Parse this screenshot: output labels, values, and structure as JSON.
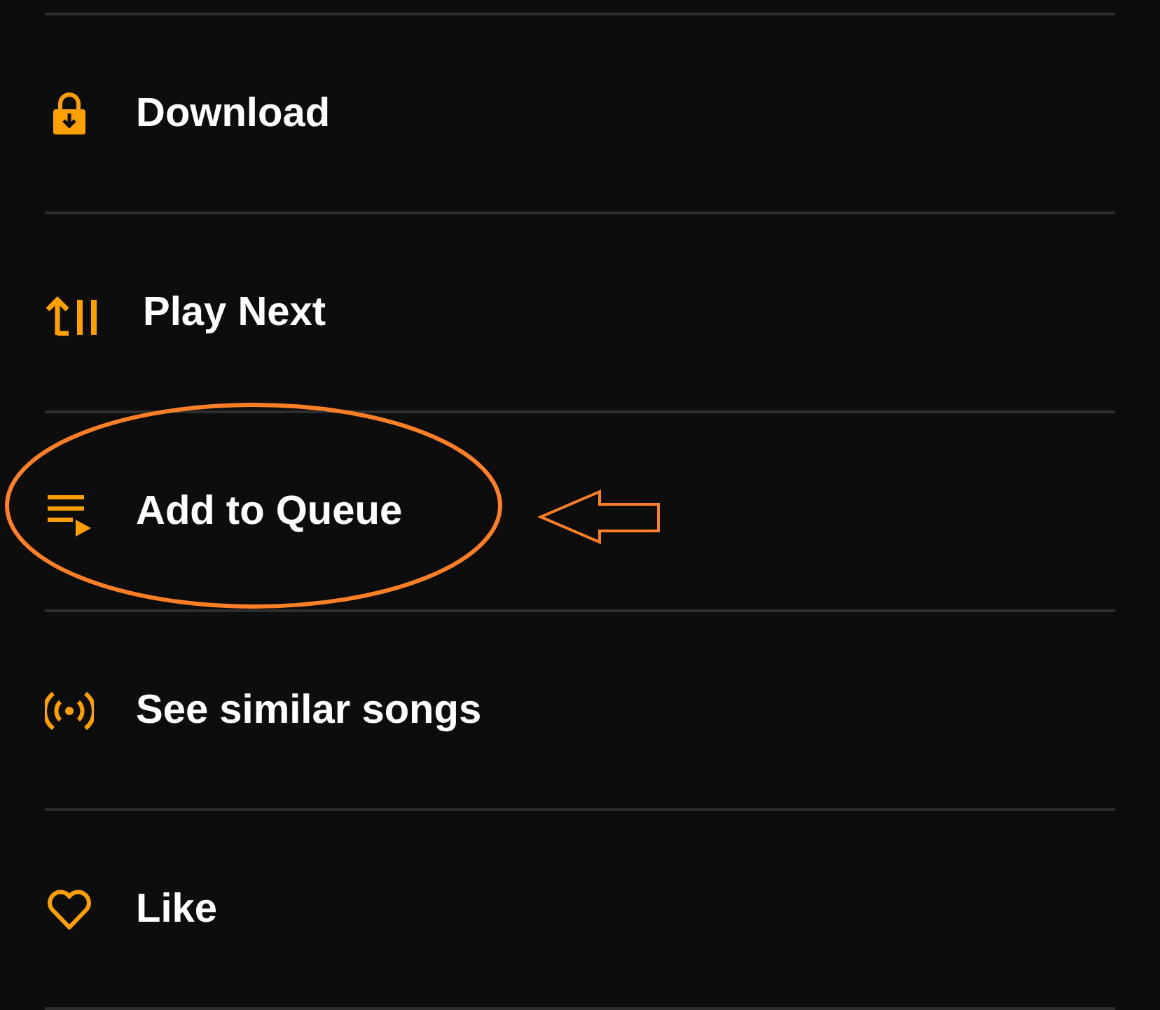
{
  "menu_items": [
    {
      "kind": "download",
      "label": "Download",
      "annotated": false
    },
    {
      "kind": "play-next",
      "label": "Play Next",
      "annotated": false
    },
    {
      "kind": "queue",
      "label": "Add to Queue",
      "annotated": true
    },
    {
      "kind": "radio",
      "label": "See similar songs",
      "annotated": false
    },
    {
      "kind": "heart",
      "label": "Like",
      "annotated": false
    }
  ]
}
